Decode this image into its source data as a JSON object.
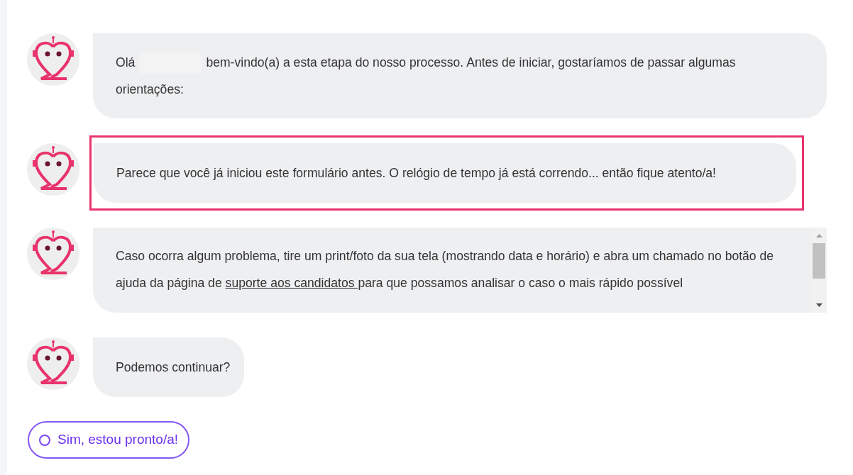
{
  "messages": [
    {
      "kind": "greeting",
      "highlighted": false,
      "greeting": "Olá",
      "text": "bem-vindo(a) a esta etapa do nosso processo. Antes de iniciar, gostaríamos de passar algumas orientações:"
    },
    {
      "kind": "plain",
      "highlighted": true,
      "text": "Parece que você já iniciou este formulário antes. O relógio de tempo já está correndo... então fique atento/a!"
    },
    {
      "kind": "scroll",
      "highlighted": false,
      "before": "Caso ocorra algum problema, tire um print/foto da sua tela (mostrando data e horário) e abra um chamado no botão de ajuda da página de",
      "link": "suporte aos candidatos ",
      "after": "para que possamos analisar o caso o mais rápido possível"
    },
    {
      "kind": "plain",
      "highlighted": false,
      "text": "Podemos continuar?"
    }
  ],
  "options": [
    {
      "label": "Sim, estou pronto/a!",
      "selected": false
    }
  ]
}
